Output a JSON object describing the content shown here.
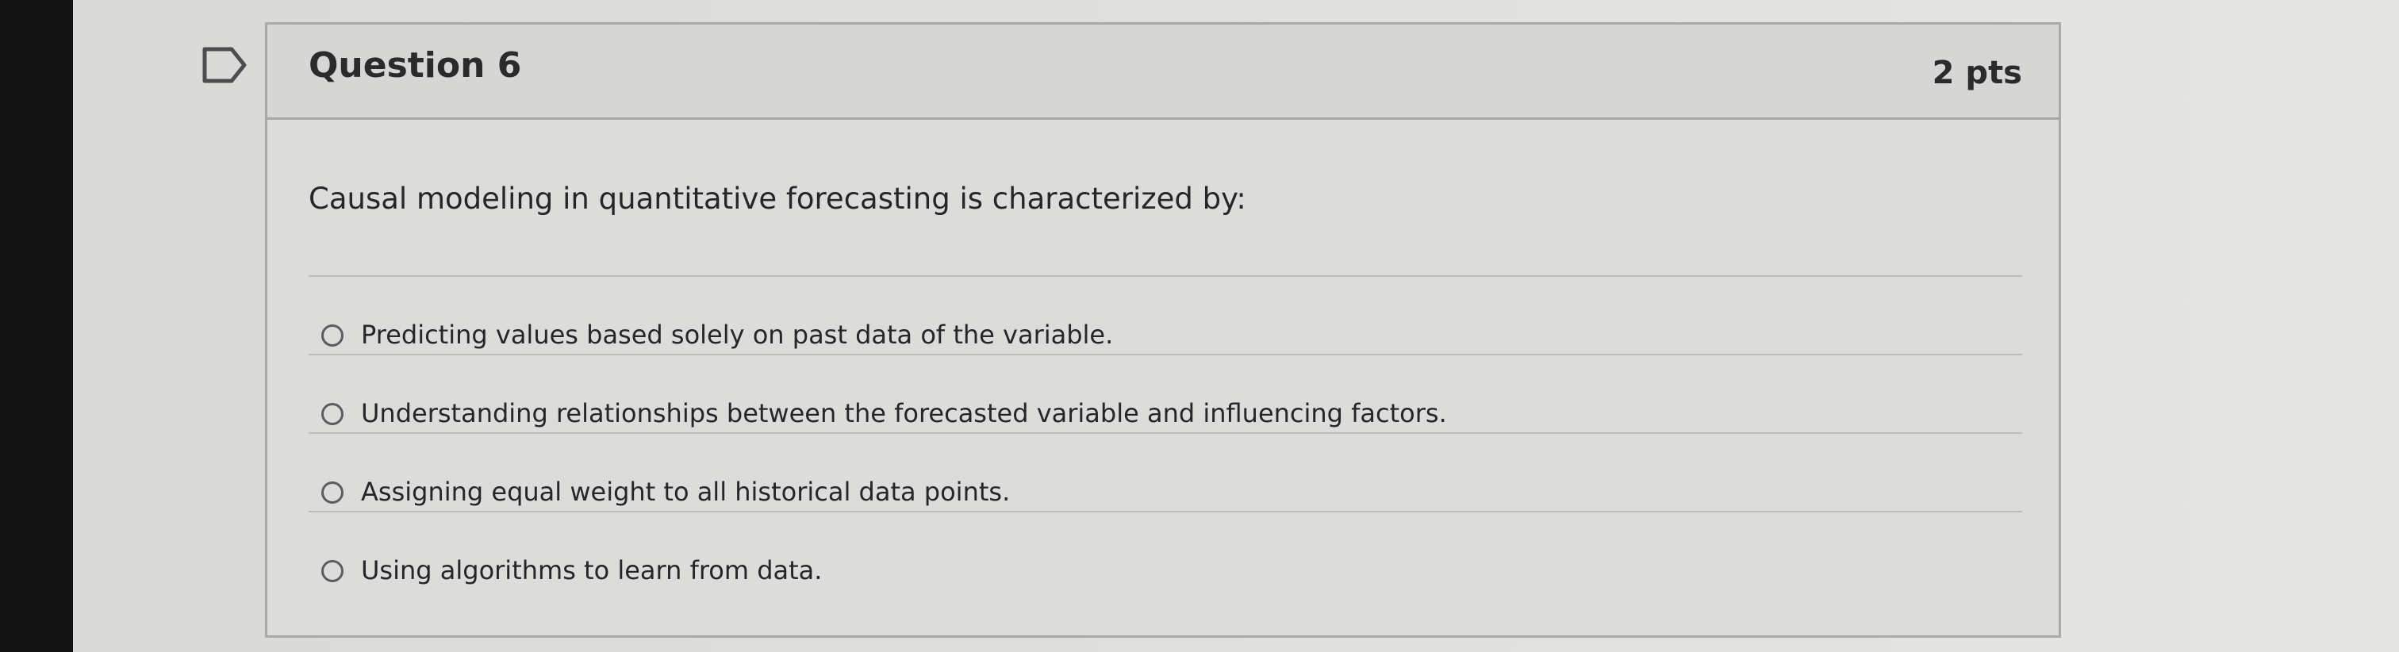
{
  "question": {
    "title": "Question 6",
    "points": "2 pts",
    "prompt": "Causal modeling in quantitative forecasting is characterized by:",
    "answers": [
      {
        "label": "Predicting values based solely on past data of the variable."
      },
      {
        "label": "Understanding relationships between the forecasted variable and influencing factors."
      },
      {
        "label": "Assigning equal weight to all historical data points."
      },
      {
        "label": "Using algorithms to learn from data."
      }
    ]
  },
  "icons": {
    "flag": "flag-question-icon",
    "radio": "radio-button-icon"
  },
  "colors": {
    "background": "#dededc",
    "border": "#a9aaa8",
    "text": "#2b2b2b",
    "bezel": "#141414"
  }
}
